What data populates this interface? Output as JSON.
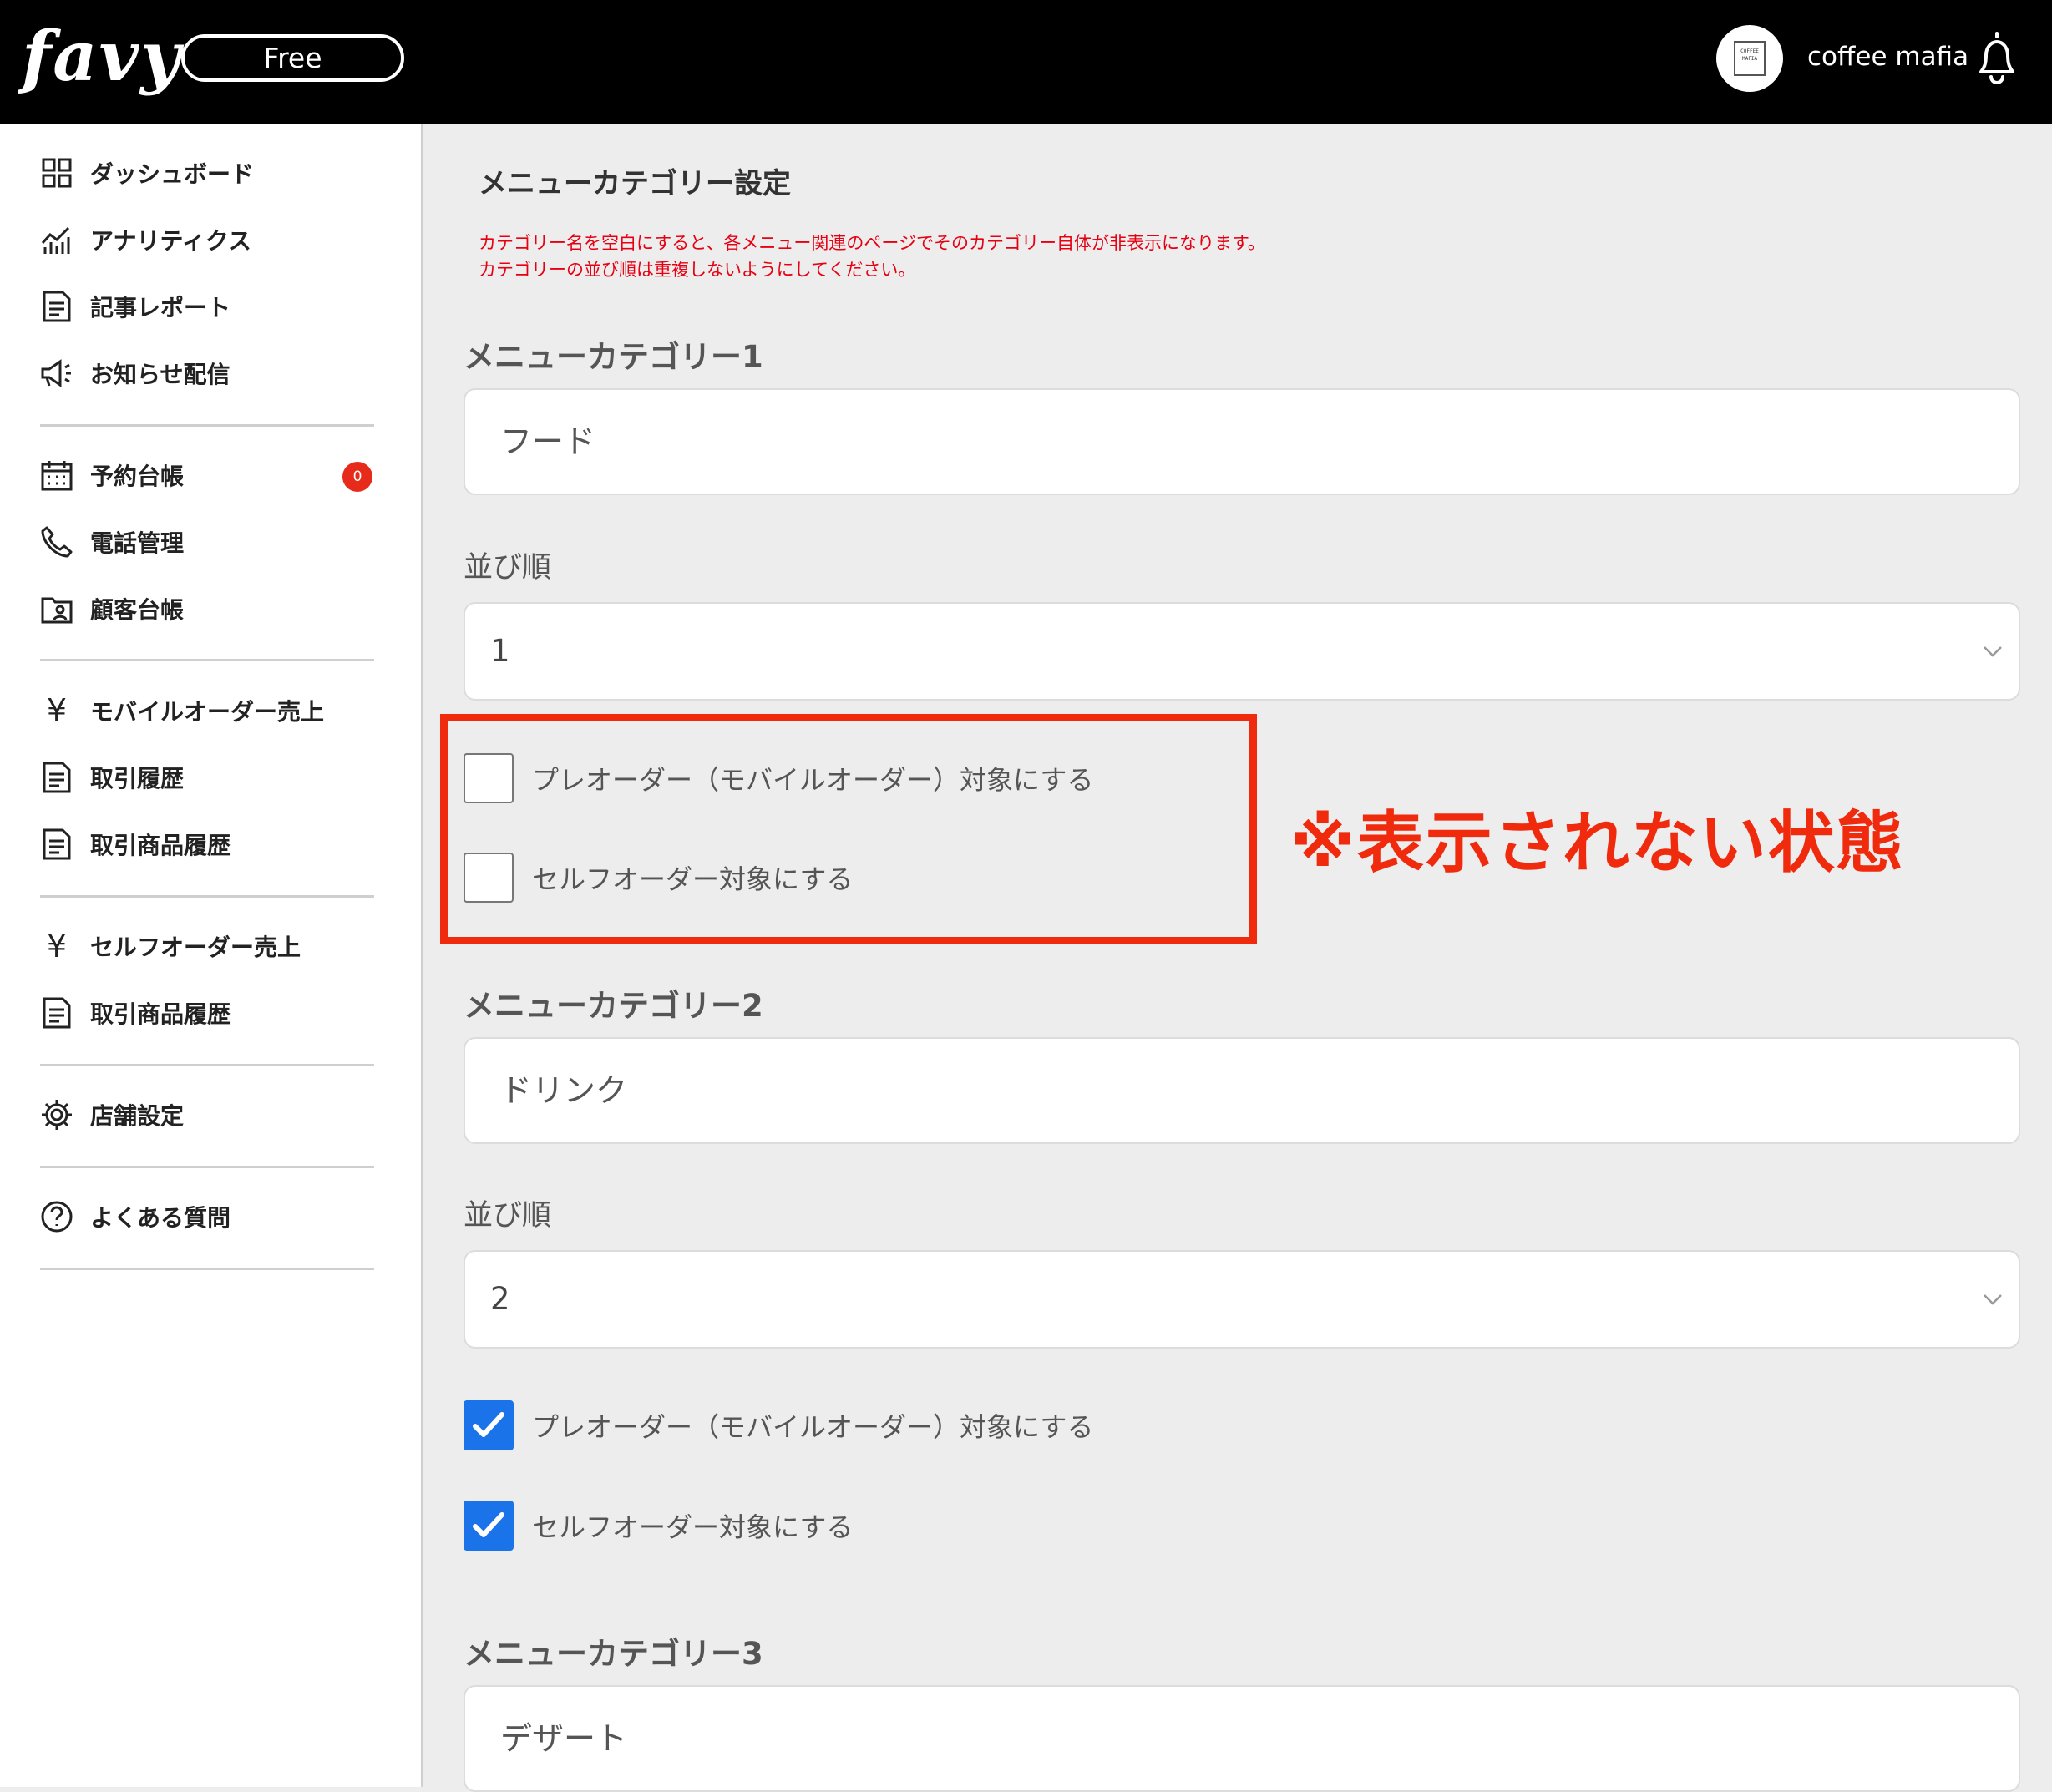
{
  "header": {
    "logo": "favy",
    "plan": "Free",
    "avatar_text": "COFFEE MAFIA",
    "username": "coffee mafia"
  },
  "sidebar": {
    "items": [
      {
        "label": "ダッシュボード",
        "icon": "dashboard-grid-icon"
      },
      {
        "label": "アナリティクス",
        "icon": "analytics-chart-icon"
      },
      {
        "label": "記事レポート",
        "icon": "document-icon"
      },
      {
        "label": "お知らせ配信",
        "icon": "megaphone-icon"
      },
      {
        "label": "予約台帳",
        "icon": "calendar-icon",
        "badge": "0"
      },
      {
        "label": "電話管理",
        "icon": "phone-icon"
      },
      {
        "label": "顧客台帳",
        "icon": "customer-folder-icon"
      },
      {
        "label": "モバイルオーダー売上",
        "icon": "yen-icon"
      },
      {
        "label": "取引履歴",
        "icon": "document-icon"
      },
      {
        "label": "取引商品履歴",
        "icon": "document-icon"
      },
      {
        "label": "セルフオーダー売上",
        "icon": "yen-icon"
      },
      {
        "label": "取引商品履歴",
        "icon": "document-icon"
      },
      {
        "label": "店舗設定",
        "icon": "gear-icon"
      },
      {
        "label": "よくある質問",
        "icon": "question-circle-icon"
      }
    ],
    "yen_symbol": "¥"
  },
  "main": {
    "title": "メニューカテゴリー設定",
    "notice_line1": "カテゴリー名を空白にすると、各メニュー関連のページでそのカテゴリー自体が非表示になります。",
    "notice_line2": "カテゴリーの並び順は重複しないようにしてください。",
    "order_label": "並び順",
    "preorder_label": "プレオーダー（モバイルオーダー）対象にする",
    "selforder_label": "セルフオーダー対象にする",
    "categories": [
      {
        "heading": "メニューカテゴリー1",
        "name": "フード",
        "order": "1",
        "preorder": false,
        "selforder": false
      },
      {
        "heading": "メニューカテゴリー2",
        "name": "ドリンク",
        "order": "2",
        "preorder": true,
        "selforder": true
      },
      {
        "heading": "メニューカテゴリー3",
        "name": "デザート"
      }
    ]
  },
  "annotation": {
    "text": "※表示されない状態",
    "color": "#f02a0c"
  },
  "colors": {
    "accent": "#1a73e8",
    "notice": "#e60012",
    "badge": "#e62b1a"
  }
}
